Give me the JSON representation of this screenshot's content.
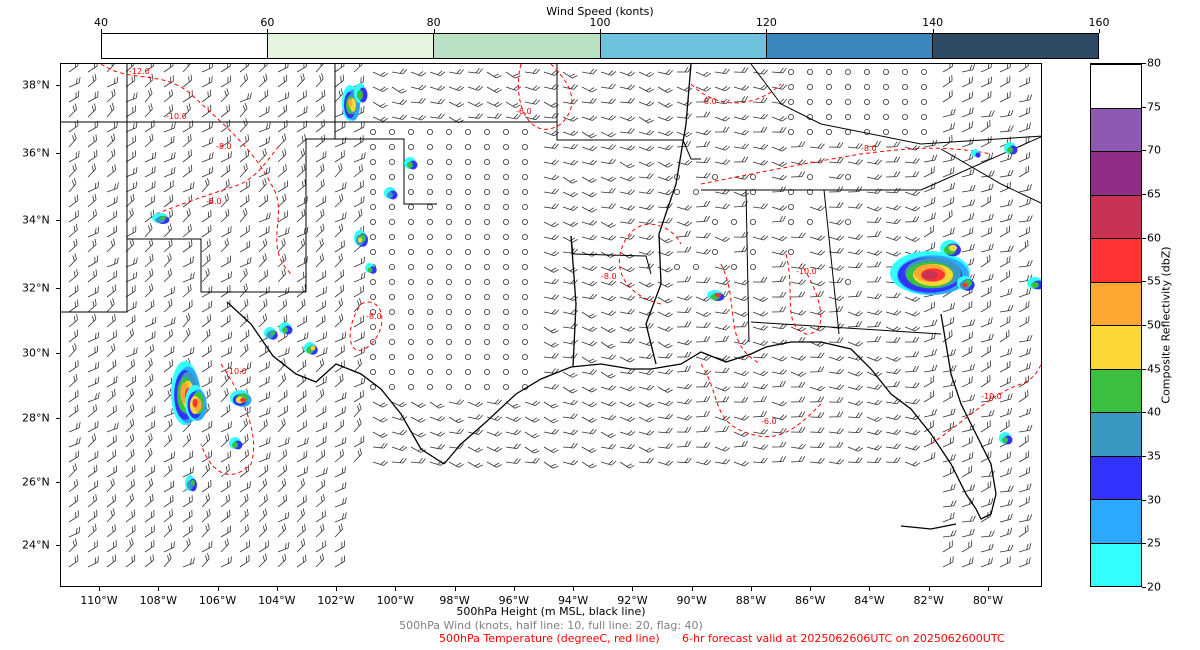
{
  "wind_colorbar": {
    "title": "Wind Speed (konts)",
    "ticks": [
      "40",
      "60",
      "80",
      "100",
      "120",
      "140",
      "160"
    ],
    "colors": [
      "#ffffff",
      "#e5f4df",
      "#b8e2c3",
      "#6ec2db",
      "#3a87be",
      "#2f4a65"
    ]
  },
  "reflectivity_colorbar": {
    "title": "Composite Reflectivity (dbZ)",
    "ticks": [
      "20",
      "25",
      "30",
      "35",
      "40",
      "45",
      "50",
      "55",
      "60",
      "65",
      "70",
      "75",
      "80"
    ],
    "colors": [
      "#33ffff",
      "#2aa9ff",
      "#3333ff",
      "#3a97c1",
      "#3abf3f",
      "#fdd835",
      "#fea731",
      "#ff3333",
      "#c93254",
      "#922d86",
      "#8f59b3",
      "#ffffff"
    ]
  },
  "map": {
    "lat_labels": [
      "38°N",
      "36°N",
      "34°N",
      "32°N",
      "30°N",
      "28°N",
      "26°N",
      "24°N"
    ],
    "lon_labels": [
      "110°W",
      "108°W",
      "106°W",
      "104°W",
      "102°W",
      "100°W",
      "98°W",
      "96°W",
      "94°W",
      "92°W",
      "90°W",
      "88°W",
      "86°W",
      "84°W",
      "82°W",
      "80°W"
    ],
    "temperature_contour_labels": [
      "-12.0",
      "-10.0",
      "-8.0",
      "-6.0",
      "-10.0",
      "-8.0",
      "-6.0",
      "-8.0",
      "-10.0",
      "-8.0",
      "-6.0",
      "-8.0",
      "-10.0"
    ]
  },
  "footer": {
    "height_line": "500hPa Height (m MSL, black line)",
    "wind_line": "500hPa Wind (knots, half line: 10, full line: 20, flag: 40)",
    "temp_line": "500hPa Temperature (degreeC, red line)",
    "forecast_line": "6-hr forecast valid at 2025062606UTC on 2025062600UTC"
  },
  "colors": {
    "height_line": "#000000",
    "wind_line": "#808080",
    "temp_line": "#ff0000"
  }
}
